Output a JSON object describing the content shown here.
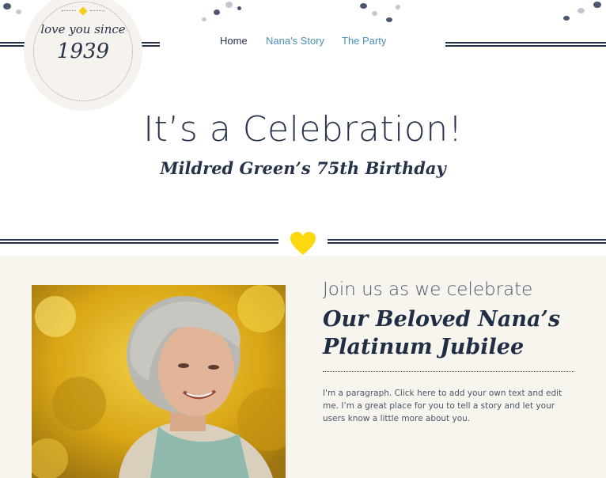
{
  "badge": {
    "line1": "love you since",
    "line2": "1939"
  },
  "nav": {
    "items": [
      {
        "label": "Home"
      },
      {
        "label": "Nana's Story"
      },
      {
        "label": "The Party"
      }
    ]
  },
  "hero": {
    "title": "It’s a Celebration!",
    "subtitle": "Mildred Green’s 75th Birthday"
  },
  "story": {
    "intro": "Join us as we celebrate",
    "heading_line1": "Our Beloved Nana’s",
    "heading_line2": "Platinum Jubilee",
    "paragraph": "I'm a paragraph. Click here to add your own text and edit me. I’m a great place for you to tell a story and let your users know a little more about you."
  },
  "colors": {
    "navy": "#26324a",
    "link_blue": "#4a8fb6",
    "heart_yellow": "#fcd80e",
    "section_bg": "#f7f5ed"
  },
  "icons": {
    "divider": "heart-icon",
    "badge": "diamond-icon"
  }
}
